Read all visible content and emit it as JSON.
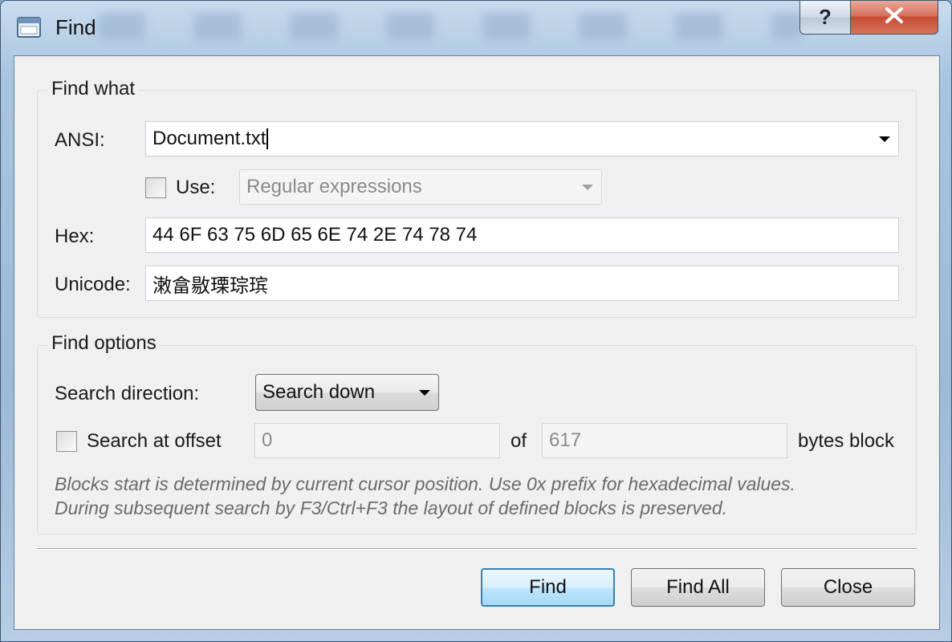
{
  "window": {
    "title": "Find",
    "help_label": "?",
    "icons": {
      "app": "app-window-icon",
      "help": "help-icon",
      "close": "close-icon"
    }
  },
  "find_what": {
    "group_label": "Find what",
    "ansi_label": "ANSI:",
    "ansi_value": "Document.txt",
    "use_label": "Use:",
    "use_checked": false,
    "use_mode": "Regular expressions",
    "hex_label": "Hex:",
    "hex_value": "44 6F 63 75 6D 65 6E 74 2E 74 78 74",
    "unicode_label": "Unicode:",
    "unicode_value": "潄畣敭瑮琮瑸"
  },
  "find_options": {
    "group_label": "Find options",
    "direction_label": "Search direction:",
    "direction_value": "Search down",
    "offset_label": "Search at offset",
    "offset_checked": false,
    "offset_value": "0",
    "of_label": "of",
    "block_size": "617",
    "bytes_label": "bytes block",
    "hint_line1": "Blocks start is determined by current cursor position. Use 0x prefix for hexadecimal values.",
    "hint_line2": "During subsequent search by F3/Ctrl+F3 the layout of defined blocks is preserved."
  },
  "buttons": {
    "find": "Find",
    "find_all": "Find All",
    "close": "Close"
  },
  "colors": {
    "accent": "#3c7fb1",
    "close_button": "#c74b34",
    "hint_text": "#6b6b6b"
  }
}
